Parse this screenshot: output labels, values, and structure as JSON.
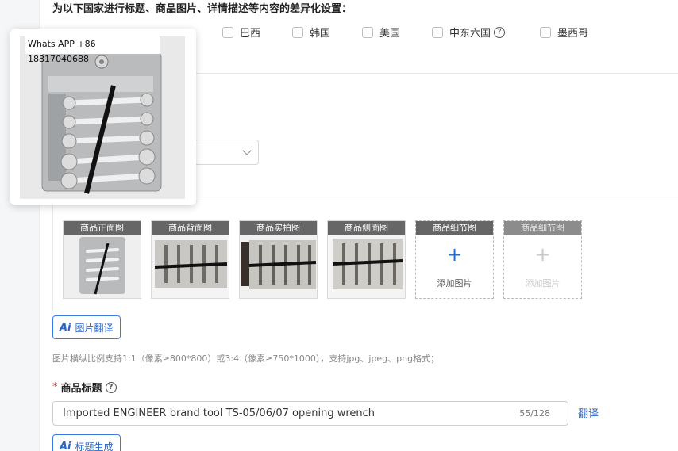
{
  "settings": {
    "heading": "为以下国家进行标题、商品图片、详情描述等内容的差异化设置：",
    "countries": [
      {
        "label": "巴西"
      },
      {
        "label": "韩国"
      },
      {
        "label": "美国"
      },
      {
        "label": "中东六国"
      },
      {
        "label": "墨西哥"
      }
    ]
  },
  "popover": {
    "caption": "Whats APP +86 18817040688"
  },
  "images": {
    "slots": [
      {
        "label": "商品正面图",
        "state": "filled"
      },
      {
        "label": "商品背面图",
        "state": "filled"
      },
      {
        "label": "商品实拍图",
        "state": "filled"
      },
      {
        "label": "商品侧面图",
        "state": "filled"
      },
      {
        "label": "商品细节图",
        "state": "add",
        "add_label": "添加图片"
      },
      {
        "label": "商品细节图",
        "state": "add-disabled",
        "add_label": "添加图片"
      }
    ],
    "translate_button": "图片翻译",
    "hint": "图片横纵比例支持1:1（像素≥800*800）或3:4（像素≥750*1000），支持jpg、jpeg、png格式；"
  },
  "title_field": {
    "label": "商品标题",
    "value": "Imported ENGINEER brand tool TS-05/06/07 opening wrench",
    "count": "55/128",
    "translate_link": "翻译",
    "generate_button": "标题生成"
  },
  "colors": {
    "accent": "#2a66c9",
    "required": "#e53935",
    "thumb_label_bg": "#666666"
  }
}
